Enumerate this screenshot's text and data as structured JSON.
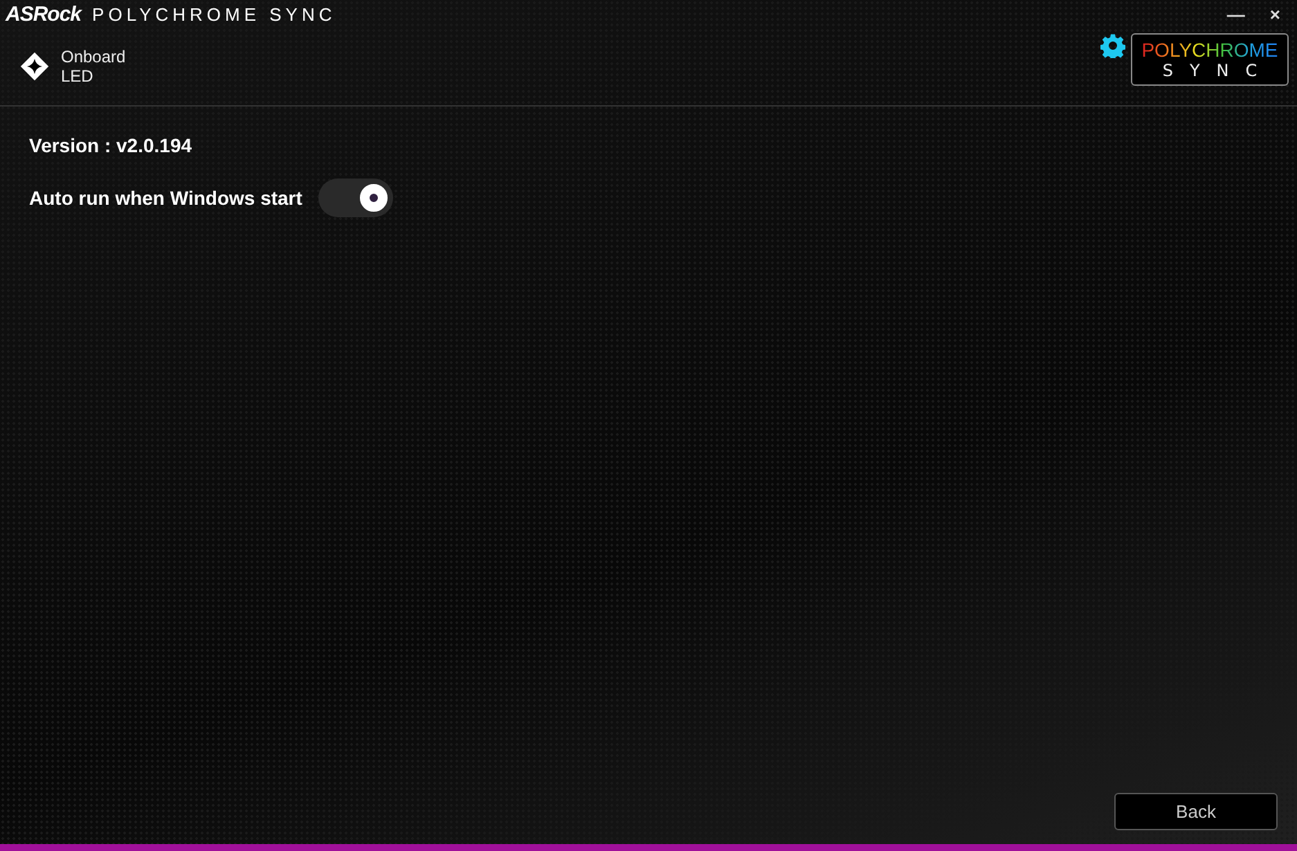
{
  "window": {
    "brand": "ASRock",
    "title": "POLYCHROME SYNC",
    "controls": [
      "—",
      "×"
    ]
  },
  "nav": {
    "label": "Onboard LED"
  },
  "logo": {
    "top": "POLYCHROME",
    "bottom": "SYNC"
  },
  "settings": [
    {
      "kind": "text",
      "label": "Version : v2.0.194"
    },
    {
      "kind": "toggle",
      "label": "Auto run when Windows start",
      "on": true
    }
  ],
  "buttons": [
    "Back"
  ]
}
